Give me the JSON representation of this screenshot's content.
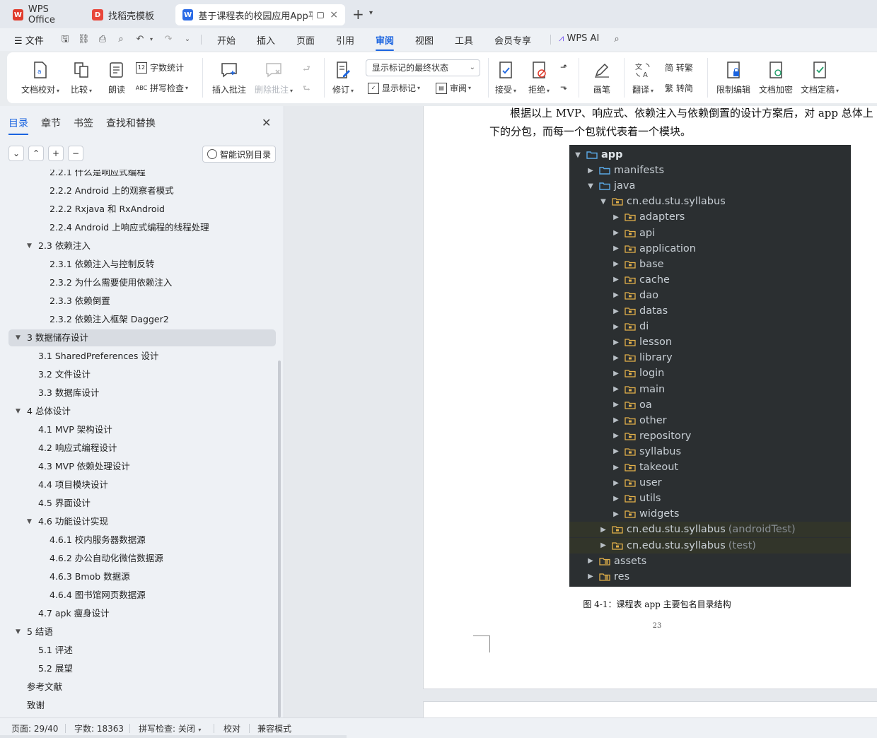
{
  "tabs": [
    {
      "label": "WPS Office",
      "icon": "wps-logo-icon",
      "color": "#e03b2c"
    },
    {
      "label": "找稻壳模板",
      "icon": "docer-icon",
      "color": "#e8463a"
    },
    {
      "label": "基于课程表的校园应用App平台",
      "icon": "word-doc-icon",
      "color": "#2b6be6"
    }
  ],
  "menu": {
    "file": "文件",
    "items": [
      "开始",
      "插入",
      "页面",
      "引用",
      "审阅",
      "视图",
      "工具",
      "会员专享"
    ],
    "active": "审阅",
    "ai": "WPS AI"
  },
  "ribbon": {
    "proofread": "文档校对",
    "compare": "比较",
    "read_aloud": "朗读",
    "word_count": "字数统计",
    "spell_check": "拼写检查",
    "insert_comment": "插入批注",
    "delete_comment": "删除批注",
    "track_changes": "修订",
    "display_state": "显示标记的最终状态",
    "show_markup": "显示标记",
    "review": "审阅",
    "accept": "接受",
    "reject": "拒绝",
    "pen": "画笔",
    "translate": "翻译",
    "to_traditional": "简 转繁",
    "to_simplified": "繁 转简",
    "restrict_edit": "限制编辑",
    "encrypt": "文档加密",
    "finalize": "文档定稿"
  },
  "nav": {
    "tabs": [
      "目录",
      "章节",
      "书签",
      "查找和替换"
    ],
    "active_tab": "目录",
    "smart_button": "智能识别目录",
    "toc": [
      {
        "label": "2.2.1 什么是响应式编程",
        "level": 3
      },
      {
        "label": "2.2.2 Android 上的观察者模式",
        "level": 3
      },
      {
        "label": "2.2.2 Rxjava 和 RxAndroid",
        "level": 3
      },
      {
        "label": "2.2.4 Android 上响应式编程的线程处理",
        "level": 3
      },
      {
        "label": "2.3  依赖注入",
        "level": 2,
        "expanded": true
      },
      {
        "label": "2.3.1 依赖注入与控制反转",
        "level": 3
      },
      {
        "label": "2.3.2 为什么需要使用依赖注入",
        "level": 3
      },
      {
        "label": "2.3.3  依赖倒置",
        "level": 3
      },
      {
        "label": "2.3.2  依赖注入框架 Dagger2",
        "level": 3
      },
      {
        "label": "3  数据储存设计",
        "level": 1,
        "expanded": true,
        "selected": true
      },
      {
        "label": "3.1 SharedPreferences 设计",
        "level": 2
      },
      {
        "label": "3.2  文件设计",
        "level": 2
      },
      {
        "label": "3.3  数据库设计",
        "level": 2
      },
      {
        "label": "4  总体设计",
        "level": 1,
        "expanded": true
      },
      {
        "label": "4.1 MVP 架构设计",
        "level": 2
      },
      {
        "label": "4.2  响应式编程设计",
        "level": 2
      },
      {
        "label": "4.3 MVP 依赖处理设计",
        "level": 2
      },
      {
        "label": "4.4  项目模块设计",
        "level": 2
      },
      {
        "label": "4.5  界面设计",
        "level": 2
      },
      {
        "label": "4.6  功能设计实现",
        "level": 2,
        "expanded": true
      },
      {
        "label": "4.6.1 校内服务器数据源",
        "level": 3
      },
      {
        "label": "4.6.2  办公自动化微信数据源",
        "level": 3
      },
      {
        "label": "4.6.3 Bmob 数据源",
        "level": 3
      },
      {
        "label": "4.6.4  图书馆网页数据源",
        "level": 3
      },
      {
        "label": "4.7 apk 瘦身设计",
        "level": 2
      },
      {
        "label": "5  结语",
        "level": 1,
        "expanded": true
      },
      {
        "label": "5.1  评述",
        "level": 2
      },
      {
        "label": "5.2  展望",
        "level": 2
      },
      {
        "label": "参考文献",
        "level": 1
      },
      {
        "label": "致谢",
        "level": 1
      }
    ]
  },
  "document": {
    "line1": "根据以上 MVP、响应式、依赖注入与依赖倒置的设计方案后，对 app 总体上",
    "line2": "下的分包，而每一个包就代表着一个模块。",
    "tree": [
      {
        "name": "app",
        "depth": 0,
        "expanded": true,
        "kind": "module"
      },
      {
        "name": "manifests",
        "depth": 1,
        "expanded": false,
        "kind": "blue"
      },
      {
        "name": "java",
        "depth": 1,
        "expanded": true,
        "kind": "blue"
      },
      {
        "name": "cn.edu.stu.syllabus",
        "depth": 2,
        "expanded": true,
        "kind": "pkg"
      },
      {
        "name": "adapters",
        "depth": 3,
        "expanded": false,
        "kind": "pkg"
      },
      {
        "name": "api",
        "depth": 3,
        "expanded": false,
        "kind": "pkg"
      },
      {
        "name": "application",
        "depth": 3,
        "expanded": false,
        "kind": "pkg"
      },
      {
        "name": "base",
        "depth": 3,
        "expanded": false,
        "kind": "pkg"
      },
      {
        "name": "cache",
        "depth": 3,
        "expanded": false,
        "kind": "pkg"
      },
      {
        "name": "dao",
        "depth": 3,
        "expanded": false,
        "kind": "pkg"
      },
      {
        "name": "datas",
        "depth": 3,
        "expanded": false,
        "kind": "pkg"
      },
      {
        "name": "di",
        "depth": 3,
        "expanded": false,
        "kind": "pkg"
      },
      {
        "name": "lesson",
        "depth": 3,
        "expanded": false,
        "kind": "pkg"
      },
      {
        "name": "library",
        "depth": 3,
        "expanded": false,
        "kind": "pkg"
      },
      {
        "name": "login",
        "depth": 3,
        "expanded": false,
        "kind": "pkg"
      },
      {
        "name": "main",
        "depth": 3,
        "expanded": false,
        "kind": "pkg"
      },
      {
        "name": "oa",
        "depth": 3,
        "expanded": false,
        "kind": "pkg"
      },
      {
        "name": "other",
        "depth": 3,
        "expanded": false,
        "kind": "pkg"
      },
      {
        "name": "repository",
        "depth": 3,
        "expanded": false,
        "kind": "pkg"
      },
      {
        "name": "syllabus",
        "depth": 3,
        "expanded": false,
        "kind": "pkg"
      },
      {
        "name": "takeout",
        "depth": 3,
        "expanded": false,
        "kind": "pkg"
      },
      {
        "name": "user",
        "depth": 3,
        "expanded": false,
        "kind": "pkg"
      },
      {
        "name": "utils",
        "depth": 3,
        "expanded": false,
        "kind": "pkg"
      },
      {
        "name": "widgets",
        "depth": 3,
        "expanded": false,
        "kind": "pkg"
      },
      {
        "name": "cn.edu.stu.syllabus",
        "suffix": "(androidTest)",
        "depth": 2,
        "expanded": false,
        "kind": "pkg",
        "highlight": true
      },
      {
        "name": "cn.edu.stu.syllabus",
        "suffix": "(test)",
        "depth": 2,
        "expanded": false,
        "kind": "pkg",
        "highlight": true
      },
      {
        "name": "assets",
        "depth": 1,
        "expanded": false,
        "kind": "res"
      },
      {
        "name": "res",
        "depth": 1,
        "expanded": false,
        "kind": "res"
      }
    ],
    "caption": "图 4-1：课程表 app 主要包名目录结构",
    "page_number": "23"
  },
  "status": {
    "page": "页面: 29/40",
    "words": "字数: 18363",
    "spell": "拼写检查: 关闭",
    "proof": "校对",
    "compat": "兼容模式"
  },
  "colors": {
    "accent": "#1a64e0",
    "ide_bg": "#2b2f31",
    "folder_blue": "#5aa9e6",
    "folder_pkg": "#e2b04a"
  }
}
